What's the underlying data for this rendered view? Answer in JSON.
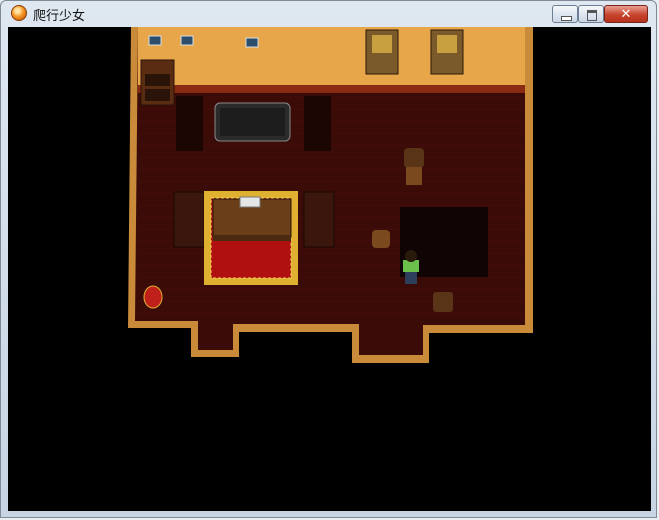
{
  "window": {
    "title": "爬行少女",
    "icon": "orange-sphere-icon",
    "buttons": {
      "minimize_icon": "minimize-icon",
      "maximize_icon": "maximize-icon",
      "close_icon": "close-icon"
    }
  },
  "scene": {
    "background": "#000000",
    "wall_color": "#e8a64a",
    "floor_color": "#3e0b08",
    "border_color": "#c98a3a",
    "objects": [
      "picture-frame",
      "picture-frame",
      "picture-frame",
      "bookshelf",
      "armchair",
      "armchair",
      "armchair",
      "armchair",
      "wooden-chair",
      "wooden-chair",
      "wooden-chair",
      "sofa",
      "rug",
      "desk",
      "open-book",
      "shadow-table",
      "red-vase",
      "player-character"
    ]
  },
  "colors": {
    "close_button": "#c8432c",
    "rug_red": "#b01010",
    "rug_gold": "#e0b030"
  }
}
